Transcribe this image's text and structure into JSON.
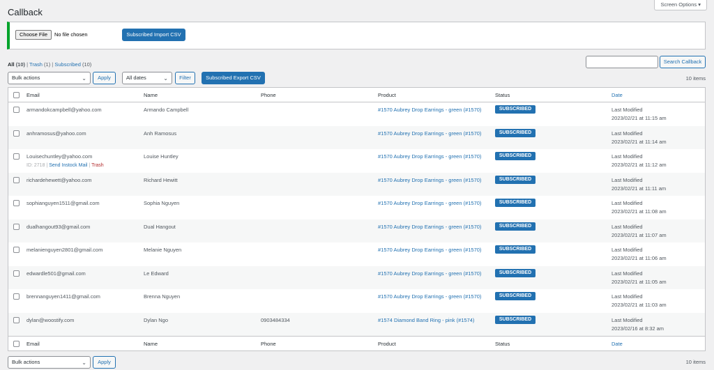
{
  "page": {
    "title": "Callback",
    "screen_options": "Screen Options"
  },
  "import": {
    "choose_file": "Choose File",
    "file_status": "No file chosen",
    "import_button": "Subscribed Import CSV"
  },
  "views": {
    "all": "All",
    "all_count": "(10)",
    "trash": "Trash",
    "trash_count": "(1)",
    "subscribed": "Subscribed",
    "subscribed_count": "(10)",
    "sep": "|"
  },
  "search": {
    "value": "",
    "button": "Search Callback"
  },
  "toolbar": {
    "bulk_actions": "Bulk actions",
    "apply": "Apply",
    "dates": "All dates",
    "filter": "Filter",
    "export": "Subscribed Export CSV",
    "items_count": "10 items"
  },
  "columns": [
    "Email",
    "Name",
    "Phone",
    "Product",
    "Status",
    "Date"
  ],
  "rows": [
    {
      "email": "armandokcampbell@yahoo.com",
      "name": "Armando Campbell",
      "phone": "",
      "product": "#1570 Aubrey Drop Earrings - green (#1570)",
      "status": "SUBSCRIBED",
      "date_label": "Last Modified",
      "date": "2023/02/21 at 11:15 am"
    },
    {
      "email": "anhramosus@yahoo.com",
      "name": "Anh Ramosus",
      "phone": "",
      "product": "#1570 Aubrey Drop Earrings - green (#1570)",
      "status": "SUBSCRIBED",
      "date_label": "Last Modified",
      "date": "2023/02/21 at 11:14 am"
    },
    {
      "email": "Louisechuntley@yahoo.com",
      "name": "Louise Huntley",
      "phone": "",
      "product": "#1570 Aubrey Drop Earrings - green (#1570)",
      "status": "SUBSCRIBED",
      "date_label": "Last Modified",
      "date": "2023/02/21 at 11:12 am",
      "actions": {
        "id": "ID: 2718",
        "send": "Send Instock Mail",
        "trash": "Trash",
        "sep": "|"
      }
    },
    {
      "email": "richardehewett@yahoo.com",
      "name": "Richard Hewitt",
      "phone": "",
      "product": "#1570 Aubrey Drop Earrings - green (#1570)",
      "status": "SUBSCRIBED",
      "date_label": "Last Modified",
      "date": "2023/02/21 at 11:11 am"
    },
    {
      "email": "sophianguyen1511@gmail.com",
      "name": "Sophia Nguyen",
      "phone": "",
      "product": "#1570 Aubrey Drop Earrings - green (#1570)",
      "status": "SUBSCRIBED",
      "date_label": "Last Modified",
      "date": "2023/02/21 at 11:08 am"
    },
    {
      "email": "dualhangout93@gmail.com",
      "name": "Dual Hangout",
      "phone": "",
      "product": "#1570 Aubrey Drop Earrings - green (#1570)",
      "status": "SUBSCRIBED",
      "date_label": "Last Modified",
      "date": "2023/02/21 at 11:07 am"
    },
    {
      "email": "melanienguyen2801@gmail.com",
      "name": "Melanie Nguyen",
      "phone": "",
      "product": "#1570 Aubrey Drop Earrings - green (#1570)",
      "status": "SUBSCRIBED",
      "date_label": "Last Modified",
      "date": "2023/02/21 at 11:06 am"
    },
    {
      "email": "edwardle501@gmail.com",
      "name": "Le Edward",
      "phone": "",
      "product": "#1570 Aubrey Drop Earrings - green (#1570)",
      "status": "SUBSCRIBED",
      "date_label": "Last Modified",
      "date": "2023/02/21 at 11:05 am"
    },
    {
      "email": "brennanguyen1411@gmail.com",
      "name": "Brenna Nguyen",
      "phone": "",
      "product": "#1570 Aubrey Drop Earrings - green (#1570)",
      "status": "SUBSCRIBED",
      "date_label": "Last Modified",
      "date": "2023/02/21 at 11:03 am"
    },
    {
      "email": "dylan@woostify.com",
      "name": "Dylan Ngo",
      "phone": "0903484334",
      "product": "#1574 Diamond Band Ring - pink (#1574)",
      "status": "SUBSCRIBED",
      "date_label": "Last Modified",
      "date": "2023/02/16 at 8:32 am"
    }
  ],
  "icons": {
    "dropdown": "chevron-down-icon",
    "screen_options": "caret-down-icon"
  },
  "colors": {
    "accent": "#2271b1",
    "success_border": "#00a32a",
    "trash": "#b32d2e"
  }
}
